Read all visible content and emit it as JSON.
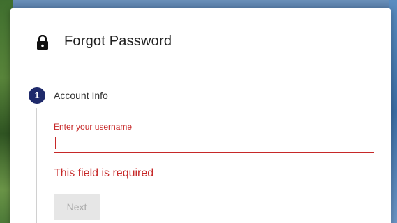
{
  "dialog": {
    "title": "Forgot Password",
    "title_icon": "lock-icon"
  },
  "stepper": {
    "steps": [
      {
        "number": "1",
        "label": "Account Info",
        "state": "active",
        "color": "#1f2a6b"
      }
    ]
  },
  "username_field": {
    "label": "Enter your username",
    "value": "",
    "error": "This field is required",
    "error_color": "#c62828"
  },
  "actions": {
    "next_label": "Next",
    "next_disabled": true
  }
}
